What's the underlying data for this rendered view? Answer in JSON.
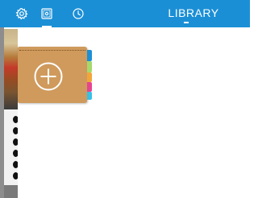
{
  "header": {
    "title": "LIBRARY",
    "background_color": "#1b8fd6",
    "icons": [
      "gear-icon",
      "camera-icon",
      "clock-icon"
    ]
  },
  "notebook": {
    "action_icon": "plus-circle-icon",
    "cover_color": "#cf9a5c",
    "tab_colors": [
      "#1c8fd6",
      "#a6d86b",
      "#f2a63a",
      "#e6458f",
      "#38c0e6"
    ]
  }
}
